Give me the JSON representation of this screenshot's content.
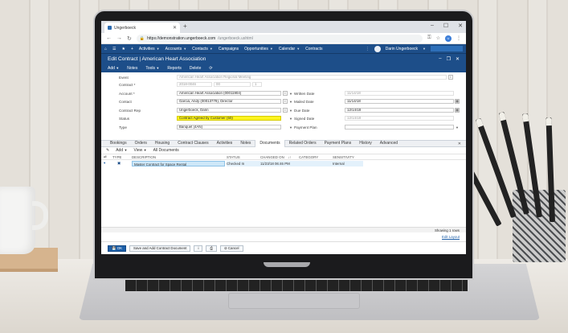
{
  "browser": {
    "tab_title": "Ungerboeck",
    "new_tab": "+",
    "window_controls": [
      "–",
      "☐",
      "✕"
    ],
    "url_host": "https://demonstration.ungerboeck.com",
    "url_path": "/ungerboeck.ushtml"
  },
  "appbar": {
    "menu": [
      "Activities",
      "Accounts",
      "Contacts",
      "Campaigns",
      "Opportunities",
      "Calendar",
      "Contracts"
    ],
    "user": "Darin Ungerboeck"
  },
  "window": {
    "title": "Edit Contract | American Heart Association",
    "toolbar": [
      "Add",
      "Notes",
      "Tools",
      "Reports",
      "Delete"
    ]
  },
  "form": {
    "event_label": "Event",
    "event_value": "American Heart Association Regional Meeting",
    "contract_label": "Contract *",
    "contract_date": "2018-0046",
    "contract_no": "00",
    "contract_extra": "1",
    "account_label": "Account *",
    "account_value": "American Heart Association (00011904)",
    "contact_label": "Contact",
    "contact_value": "Garcia, Andy (00013779), Director",
    "contract_rep_label": "Contract Rep",
    "contract_rep_value": "Ungerboeck, Darin",
    "status_label": "Status",
    "status_value": "Contract Agreed by Customer (50)",
    "type_label": "Type",
    "type_value": "Banquet (4AN)",
    "written_date_label": "Written Date",
    "written_date_value": "11/14/18",
    "mailed_date_label": "Mailed Date",
    "mailed_date_value": "11/14/18",
    "due_date_label": "Due Date",
    "due_date_value": "12/14/18",
    "signed_date_label": "Signed Date",
    "signed_date_value": "12/14/18",
    "payment_plan_label": "Payment Plan",
    "payment_plan_value": ""
  },
  "subtabs": [
    "Bookings",
    "Orders",
    "Housing",
    "Contract Clauses",
    "Activities",
    "Notes",
    "Documents",
    "Related Orders",
    "Payment Plans",
    "History",
    "Advanced"
  ],
  "grid": {
    "tool_add": "Add",
    "tool_view": "View",
    "tool_filter": "All Documents",
    "headers": [
      "TYPE",
      "DESCRIPTION",
      "STATUS",
      "CHANGED ON",
      "CATEGORY",
      "SENSITIVITY"
    ],
    "row": {
      "description": "Master Contract for Space Rental",
      "status": "Checked In",
      "changed_on": "11/23/18 06:46 PM",
      "category": "",
      "sensitivity": "Internal"
    },
    "showing": "Showing 1 rows",
    "edit_layout": "Edit Layout"
  },
  "footer": {
    "ok": "OK",
    "save_add": "Save and Add Contract Document",
    "cancel": "Cancel"
  },
  "colors": {
    "app_blue": "#1d4e89",
    "status_highlight": "#fcf420",
    "row_selected": "#cde7f8"
  }
}
